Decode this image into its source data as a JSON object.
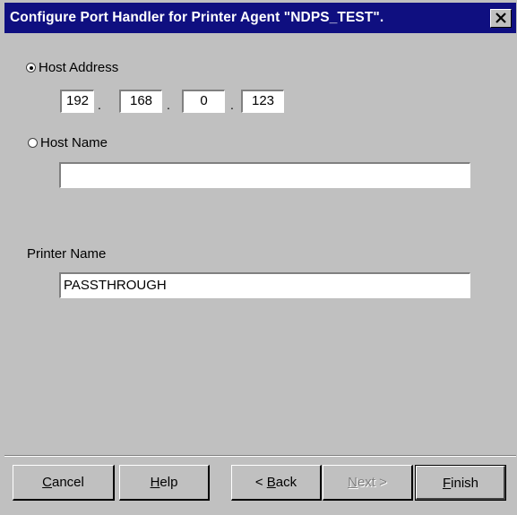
{
  "window": {
    "title": "Configure Port Handler for Printer Agent \"NDPS_TEST\"."
  },
  "host_address": {
    "label": "Host Address",
    "selected": true,
    "octets": [
      "192",
      "168",
      "0",
      "123"
    ]
  },
  "host_name": {
    "label": "Host Name",
    "selected": false,
    "value": ""
  },
  "printer_name": {
    "label": "Printer Name",
    "value": "PASSTHROUGH"
  },
  "buttons": {
    "cancel": {
      "mnemonic": "C",
      "rest": "ancel"
    },
    "help": {
      "mnemonic": "H",
      "rest": "elp"
    },
    "back": {
      "prefix": "< ",
      "mnemonic": "B",
      "rest": "ack"
    },
    "next": {
      "mnemonic": "N",
      "rest": "ext >",
      "disabled": true
    },
    "finish": {
      "mnemonic": "F",
      "rest": "inish",
      "default": true
    }
  },
  "colors": {
    "titlebar": "#0f0f80",
    "dialog_bg": "#c0c0c0"
  }
}
